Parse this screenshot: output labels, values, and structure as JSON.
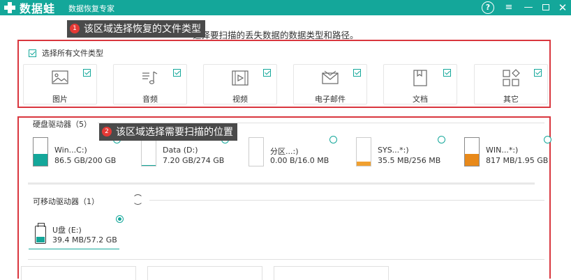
{
  "titlebar": {
    "brand": "数据蛙",
    "app_name": "数据恢复专家",
    "help_icon": "?",
    "menu_icon": "≡",
    "min_icon": "—",
    "close_icon": "✕"
  },
  "subtitle": "选择要扫描的丢失数据的数据类型和路径。",
  "callouts": [
    {
      "num": "1",
      "text": "该区域选择恢复的文件类型"
    },
    {
      "num": "2",
      "text": "该区域选择需要扫描的位置"
    }
  ],
  "file_types": {
    "select_all_label": "选择所有文件类型",
    "select_all_checked": true,
    "items": [
      {
        "label": "图片",
        "icon": "image-icon",
        "checked": true
      },
      {
        "label": "音频",
        "icon": "music-icon",
        "checked": true
      },
      {
        "label": "视频",
        "icon": "video-icon",
        "checked": true
      },
      {
        "label": "电子邮件",
        "icon": "email-icon",
        "checked": true
      },
      {
        "label": "文档",
        "icon": "document-icon",
        "checked": true
      },
      {
        "label": "其它",
        "icon": "other-icon",
        "checked": true
      }
    ]
  },
  "hard_drives": {
    "label": "硬盘驱动器（5）",
    "items": [
      {
        "name": "Win...C:)",
        "size": "86.5 GB/200 GB",
        "usage": 0.43,
        "color": "#14a79a",
        "selected": false
      },
      {
        "name": "Data (D:)",
        "size": "7.20 GB/274 GB",
        "usage": 0.03,
        "color": "#14a79a",
        "selected": false
      },
      {
        "name": "分区...:)",
        "size": "0.00  B/16.0 MB",
        "usage": 0.0,
        "color": "#f0a030",
        "selected": false
      },
      {
        "name": "SYS...*:)",
        "size": "35.5 MB/256 MB",
        "usage": 0.14,
        "color": "#f0a030",
        "selected": false
      },
      {
        "name": "WIN...*:)",
        "size": "817 MB/1.95 GB",
        "usage": 0.42,
        "color": "#e8891a",
        "selected": false
      }
    ]
  },
  "removable_drives": {
    "label": "可移动驱动器（1）",
    "items": [
      {
        "name": "U盘 (E:)",
        "size": "39.4 MB/57.2 GB",
        "selected": true
      }
    ]
  },
  "colors": {
    "accent": "#14a79a",
    "highlight_box": "#d9363e",
    "callout_bg": "#4a4a4a",
    "badge": "#e53935"
  }
}
